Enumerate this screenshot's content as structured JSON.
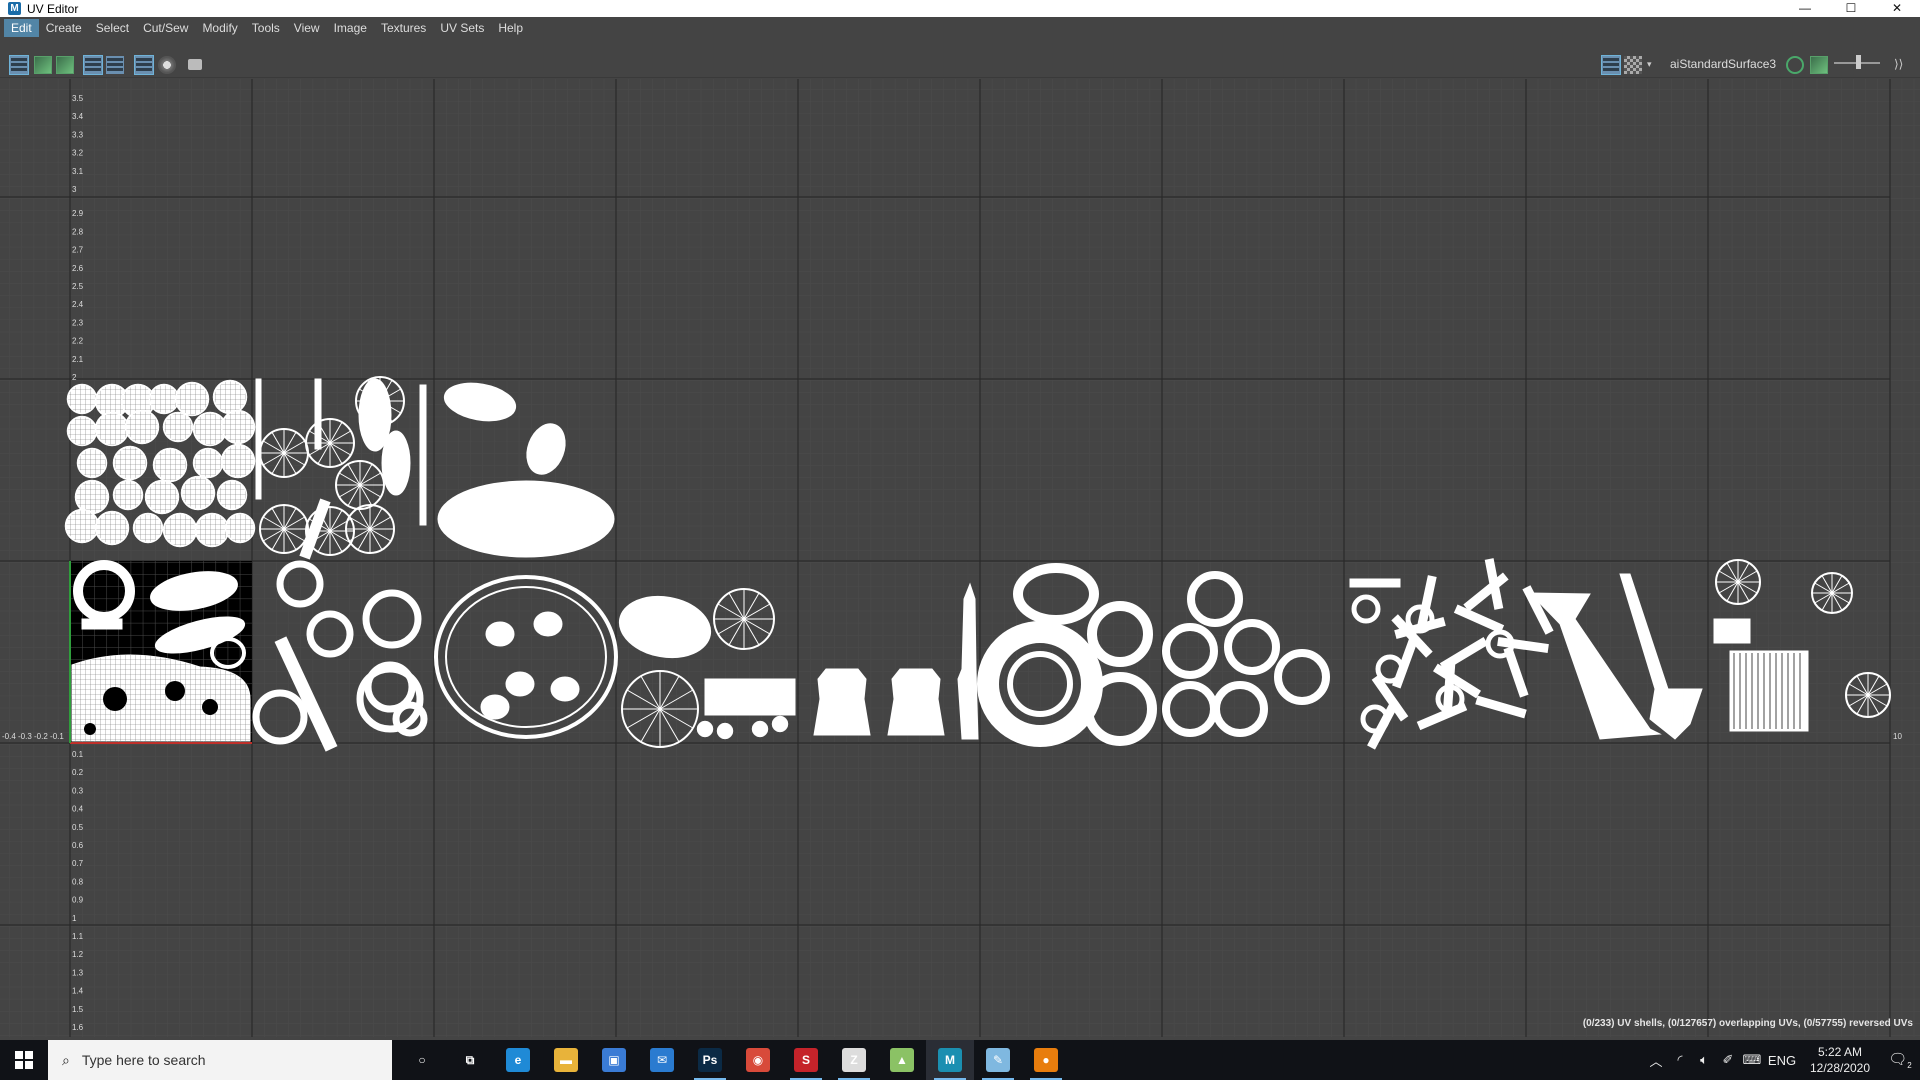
{
  "window": {
    "title": "UV Editor",
    "app_icon": "M"
  },
  "window_controls": {
    "minimize": "—",
    "maximize": "☐",
    "close": "✕"
  },
  "menu": [
    "Edit",
    "Create",
    "Select",
    "Cut/Sew",
    "Modify",
    "Tools",
    "View",
    "Image",
    "Textures",
    "UV Sets",
    "Help"
  ],
  "menu_active": "Edit",
  "toolbar": {
    "shader": "aiStandardSurface3"
  },
  "uv_axis": {
    "v_labels_top": [
      "3.5",
      "3.4",
      "3.3",
      "3.2",
      "3.1",
      "3",
      "2.9",
      "2.8",
      "2.7",
      "2.6",
      "2.5",
      "2.4",
      "2.3",
      "2.2",
      "2.1",
      "2"
    ],
    "v_labels_bottom": [
      "0.1",
      "0.2",
      "0.3",
      "0.4",
      "0.5",
      "0.6",
      "0.7",
      "0.8",
      "0.9",
      "1",
      "1.1",
      "1.2",
      "1.3",
      "1.4",
      "1.5",
      "1.6"
    ],
    "u_first_label": "-0.4 -0.3 -0.2 -0.1",
    "u_last_label": "10"
  },
  "status": "(0/233) UV shells, (0/127657) overlapping UVs, (0/57755) reversed UVs",
  "taskbar": {
    "search_placeholder": "Type here to search",
    "apps": [
      {
        "name": "cortana",
        "glyph": "○",
        "color": "#101217",
        "running": false
      },
      {
        "name": "task-view",
        "glyph": "⧉",
        "color": "#101217",
        "running": false
      },
      {
        "name": "edge",
        "glyph": "e",
        "color": "#1f8ad6",
        "running": false
      },
      {
        "name": "file-explorer",
        "glyph": "▬",
        "color": "#e8b33a",
        "running": false
      },
      {
        "name": "store",
        "glyph": "▣",
        "color": "#3a7bd5",
        "running": false
      },
      {
        "name": "mail",
        "glyph": "✉",
        "color": "#2a7bd0",
        "running": false
      },
      {
        "name": "photoshop",
        "glyph": "Ps",
        "color": "#0b2a45",
        "running": true
      },
      {
        "name": "chrome",
        "glyph": "◉",
        "color": "#d84a3a",
        "running": false
      },
      {
        "name": "substance",
        "glyph": "S",
        "color": "#c5232a",
        "running": true
      },
      {
        "name": "zbrush",
        "glyph": "Z",
        "color": "#ddd",
        "running": true
      },
      {
        "name": "image-viewer",
        "glyph": "▲",
        "color": "#8bc265",
        "running": false
      },
      {
        "name": "maya",
        "glyph": "M",
        "color": "#1b8fb1",
        "running": true,
        "current": true
      },
      {
        "name": "notepad",
        "glyph": "✎",
        "color": "#7fb8e0",
        "running": true
      },
      {
        "name": "blender",
        "glyph": "●",
        "color": "#e87d0d",
        "running": true
      }
    ],
    "tray": {
      "language": "ENG",
      "time": "5:22 AM",
      "date": "12/28/2020",
      "notifications": "2"
    }
  }
}
